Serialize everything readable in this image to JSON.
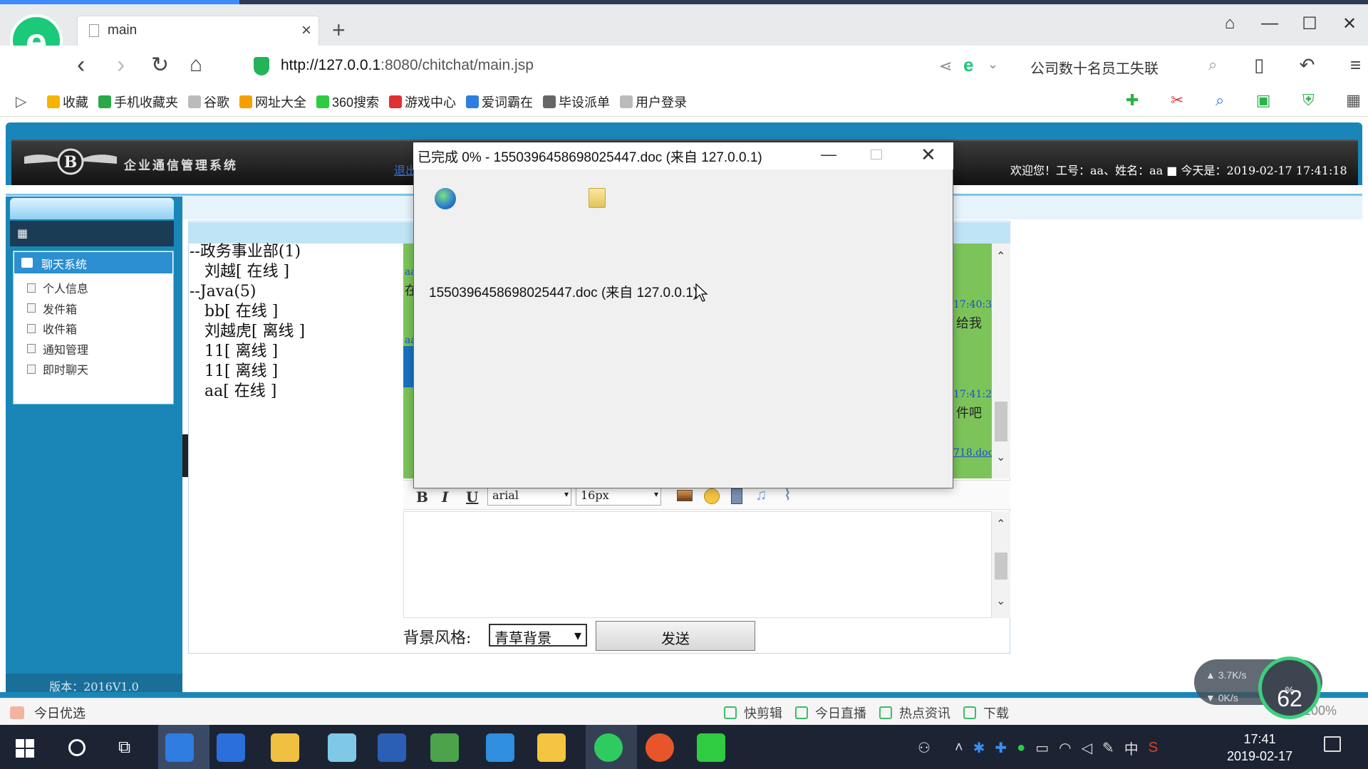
{
  "browser": {
    "tab_title": "main",
    "url_host": "http://127.0.0.1",
    "url_rest": ":8080/chitchat/main.jsp",
    "search_text": "公司数十名员工失联",
    "bookmarks": [
      {
        "label": "收藏",
        "icon": "star-icon",
        "color": "#f5b400"
      },
      {
        "label": "手机收藏夹",
        "icon": "phone-icon",
        "color": "#2aa84a"
      },
      {
        "label": "谷歌",
        "icon": "page-icon",
        "color": "#bbbbbb"
      },
      {
        "label": "网址大全",
        "icon": "compass-icon",
        "color": "#f5a000"
      },
      {
        "label": "360搜索",
        "icon": "search360-icon",
        "color": "#2ecc40"
      },
      {
        "label": "游戏中心",
        "icon": "game-icon",
        "color": "#e03030"
      },
      {
        "label": "爱词霸在",
        "icon": "dict-icon",
        "color": "#2f7de0"
      },
      {
        "label": "毕设派单",
        "icon": "image-icon",
        "color": "#666666"
      },
      {
        "label": "用户登录",
        "icon": "page-icon",
        "color": "#bbbbbb"
      }
    ]
  },
  "app": {
    "brand": "企业通信管理系统",
    "logout": "退出",
    "welcome": "欢迎您！工号：aa、姓名：aa ■ 今天是：2019-02-17 17:41:18",
    "menu_title": "聊天系统",
    "menu_items": [
      "个人信息",
      "发件箱",
      "收件箱",
      "通知管理",
      "即时聊天"
    ],
    "version": "版本：2016V1.0",
    "tree": [
      "--政务事业部(1)",
      "   刘越[ 在线 ]",
      "--Java(5)",
      "   bb[ 在线 ]",
      "   刘越虎[ 离线 ]",
      "   11[ 离线 ]",
      "   11[ 离线 ]",
      "   aa[ 在线 ]"
    ],
    "chat_fragments": {
      "time1": "17:40:3",
      "msg1": "给我",
      "time2": "17:41:2",
      "msg2": "件吧",
      "link": "718.doc",
      "left1": "aa",
      "left2": "在",
      "left3": "aa"
    },
    "toolbar": {
      "bold": "B",
      "italic": "I",
      "underline": "U",
      "font": "arial",
      "size": "16px"
    },
    "bg_label": "背景风格:",
    "bg_value": "青草背景",
    "send": "发送"
  },
  "dialog": {
    "title": "已完成 0% - 1550396458698025447.doc (来自 127.0.0.1)",
    "file_line": "1550396458698025447.doc (来自 127.0.0.1)"
  },
  "status": {
    "left": "今日优选",
    "items": [
      "快剪辑",
      "今日直播",
      "热点资讯",
      "下载"
    ],
    "zoom": "100%",
    "net_up": "3.7K/s",
    "net_down": "0K/s",
    "gauge": "62"
  },
  "taskbar": {
    "time": "17:41",
    "date": "2019-02-17",
    "ime": "中"
  }
}
